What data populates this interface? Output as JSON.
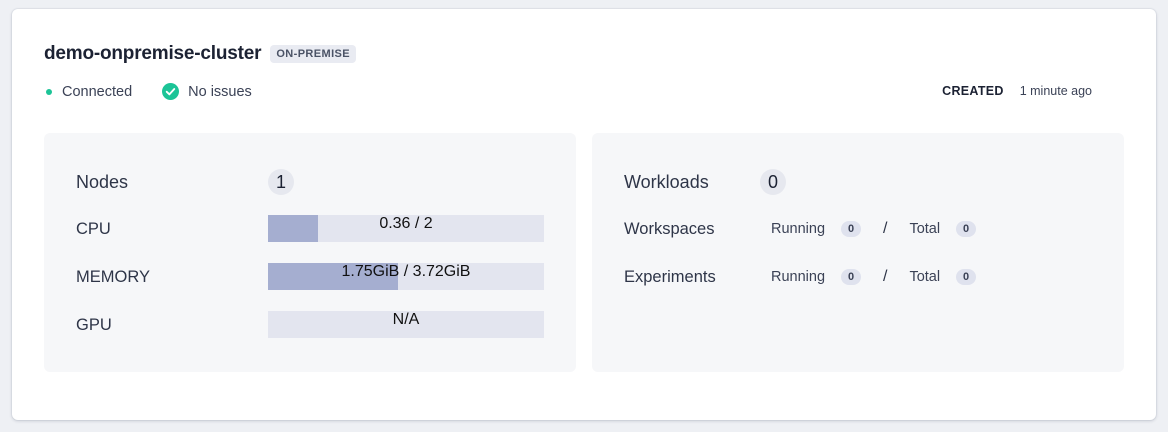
{
  "cluster": {
    "name": "demo-onpremise-cluster",
    "type_badge": "ON-PREMISE",
    "connection_status": "Connected",
    "issues_status": "No issues",
    "created_label": "CREATED",
    "created_value": "1 minute ago"
  },
  "resources": {
    "nodes_label": "Nodes",
    "nodes_count": "1",
    "cpu": {
      "label": "CPU",
      "text": "0.36 / 2",
      "used": 0.36,
      "total": 2
    },
    "memory": {
      "label": "MEMORY",
      "text": "1.75GiB / 3.72GiB",
      "used": 1.75,
      "total": 3.72
    },
    "gpu": {
      "label": "GPU",
      "text": "N/A"
    }
  },
  "workloads": {
    "label": "Workloads",
    "count": "0",
    "workspaces": {
      "label": "Workspaces",
      "running_label": "Running",
      "running": "0",
      "separator": "/",
      "total_label": "Total",
      "total": "0"
    },
    "experiments": {
      "label": "Experiments",
      "running_label": "Running",
      "running": "0",
      "separator": "/",
      "total_label": "Total",
      "total": "0"
    }
  },
  "colors": {
    "connected_dot": "#1cc497",
    "check_icon": "#1cc497",
    "bar_fill": "#a5aed0",
    "bar_track": "#e3e5ef"
  }
}
